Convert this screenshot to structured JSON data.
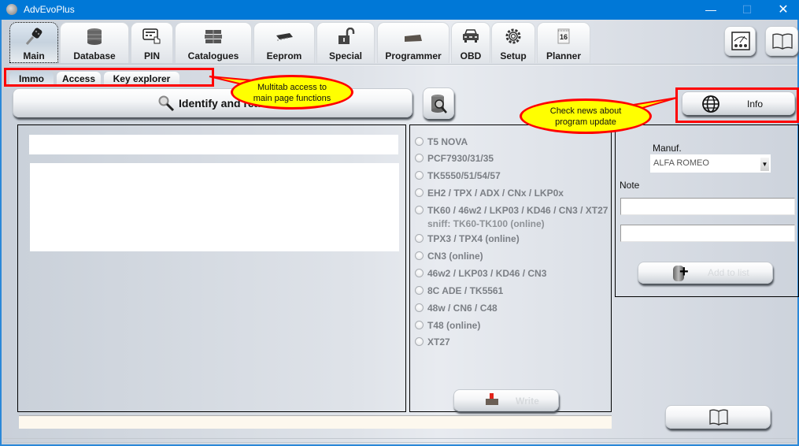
{
  "window": {
    "title": "AdvEvoPlus",
    "icon": "app-logo-icon",
    "controls": {
      "minimize": "—",
      "maximize": "☐",
      "close": "✕"
    }
  },
  "toolbar": {
    "tabs": [
      {
        "label": "Main",
        "icon": "car-key-icon",
        "active": true
      },
      {
        "label": "Database",
        "icon": "database-icon",
        "active": false
      },
      {
        "label": "PIN",
        "icon": "keypad-hand-icon",
        "active": false
      },
      {
        "label": "Catalogues",
        "icon": "books-stack-icon",
        "active": false
      },
      {
        "label": "Eeprom",
        "icon": "chip-icon",
        "active": false
      },
      {
        "label": "Special",
        "icon": "unlocked-padlock-icon",
        "active": false
      },
      {
        "label": "Programmer",
        "icon": "programmer-device-icon",
        "active": false
      },
      {
        "label": "OBD",
        "icon": "car-front-icon",
        "active": false
      },
      {
        "label": "Setup",
        "icon": "gear-icon",
        "active": false
      },
      {
        "label": "Planner",
        "icon": "calendar-icon",
        "active": false
      }
    ],
    "planner_day": "16",
    "right_buttons": [
      {
        "icon": "meter-gauge-icon"
      },
      {
        "icon": "book-icon"
      }
    ]
  },
  "subtabs": [
    {
      "label": "Immo",
      "active": true
    },
    {
      "label": "Access",
      "active": false
    },
    {
      "label": "Key explorer",
      "active": false
    }
  ],
  "actions": {
    "identify_label": "Identify and read",
    "db_search_icon": "database-search-icon",
    "info_label": "Info",
    "info_icon": "globe-icon",
    "write_label": "Write",
    "add_to_list_label": "Add to list"
  },
  "transponders": [
    {
      "label": "T5 NOVA"
    },
    {
      "label": "PCF7930/31/35"
    },
    {
      "label": "TK5550/51/54/57"
    },
    {
      "label": "EH2 / TPX / ADX / CNx / LKP0x"
    },
    {
      "label": "TK60 / 46w2 / LKP03 / KD46 / CN3 / XT27",
      "sub": "sniff: TK60-TK100 (online)"
    },
    {
      "label": "TPX3 / TPX4 (online)"
    },
    {
      "label": "CN3 (online)"
    },
    {
      "label": "46w2 / LKP03 / KD46 / CN3"
    },
    {
      "label": "8C ADE / TK5561"
    },
    {
      "label": "48w / CN6 / C48"
    },
    {
      "label": "T48 (online)"
    },
    {
      "label": "XT27"
    }
  ],
  "right_panel": {
    "manuf_label": "Manuf.",
    "manuf_value": "ALFA ROMEO",
    "note_label": "Note",
    "note_1": "",
    "note_2": ""
  },
  "status_bar": {
    "text": ""
  },
  "annotations": [
    {
      "text": "Multitab access to main page functions",
      "line1": "Multitab access to",
      "line2": "main page functions"
    },
    {
      "text": "Check news about program update",
      "line1": "Check news about",
      "line2": "program update"
    }
  ],
  "colors": {
    "titlebar": "#0078d7",
    "annotation_border": "#ff0000",
    "annotation_fill": "#ffff00",
    "status_bar_bg": "#fdf8ee"
  }
}
